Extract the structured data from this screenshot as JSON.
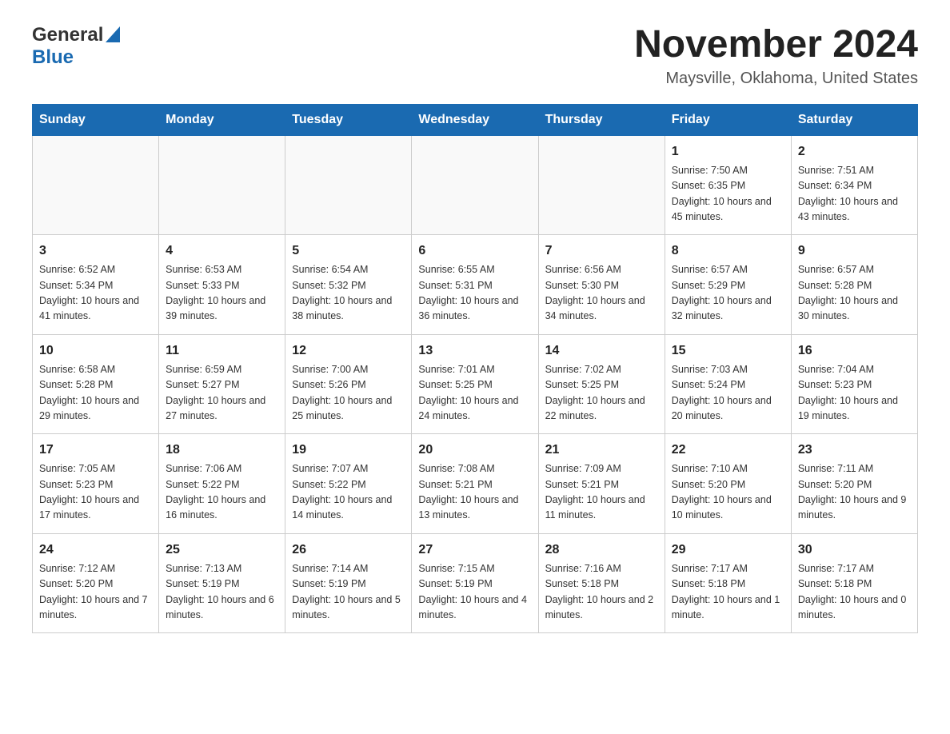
{
  "header": {
    "logo_general": "General",
    "logo_blue": "Blue",
    "month_title": "November 2024",
    "location": "Maysville, Oklahoma, United States"
  },
  "days_of_week": [
    "Sunday",
    "Monday",
    "Tuesday",
    "Wednesday",
    "Thursday",
    "Friday",
    "Saturday"
  ],
  "weeks": [
    [
      {
        "day": "",
        "sunrise": "",
        "sunset": "",
        "daylight": ""
      },
      {
        "day": "",
        "sunrise": "",
        "sunset": "",
        "daylight": ""
      },
      {
        "day": "",
        "sunrise": "",
        "sunset": "",
        "daylight": ""
      },
      {
        "day": "",
        "sunrise": "",
        "sunset": "",
        "daylight": ""
      },
      {
        "day": "",
        "sunrise": "",
        "sunset": "",
        "daylight": ""
      },
      {
        "day": "1",
        "sunrise": "Sunrise: 7:50 AM",
        "sunset": "Sunset: 6:35 PM",
        "daylight": "Daylight: 10 hours and 45 minutes."
      },
      {
        "day": "2",
        "sunrise": "Sunrise: 7:51 AM",
        "sunset": "Sunset: 6:34 PM",
        "daylight": "Daylight: 10 hours and 43 minutes."
      }
    ],
    [
      {
        "day": "3",
        "sunrise": "Sunrise: 6:52 AM",
        "sunset": "Sunset: 5:34 PM",
        "daylight": "Daylight: 10 hours and 41 minutes."
      },
      {
        "day": "4",
        "sunrise": "Sunrise: 6:53 AM",
        "sunset": "Sunset: 5:33 PM",
        "daylight": "Daylight: 10 hours and 39 minutes."
      },
      {
        "day": "5",
        "sunrise": "Sunrise: 6:54 AM",
        "sunset": "Sunset: 5:32 PM",
        "daylight": "Daylight: 10 hours and 38 minutes."
      },
      {
        "day": "6",
        "sunrise": "Sunrise: 6:55 AM",
        "sunset": "Sunset: 5:31 PM",
        "daylight": "Daylight: 10 hours and 36 minutes."
      },
      {
        "day": "7",
        "sunrise": "Sunrise: 6:56 AM",
        "sunset": "Sunset: 5:30 PM",
        "daylight": "Daylight: 10 hours and 34 minutes."
      },
      {
        "day": "8",
        "sunrise": "Sunrise: 6:57 AM",
        "sunset": "Sunset: 5:29 PM",
        "daylight": "Daylight: 10 hours and 32 minutes."
      },
      {
        "day": "9",
        "sunrise": "Sunrise: 6:57 AM",
        "sunset": "Sunset: 5:28 PM",
        "daylight": "Daylight: 10 hours and 30 minutes."
      }
    ],
    [
      {
        "day": "10",
        "sunrise": "Sunrise: 6:58 AM",
        "sunset": "Sunset: 5:28 PM",
        "daylight": "Daylight: 10 hours and 29 minutes."
      },
      {
        "day": "11",
        "sunrise": "Sunrise: 6:59 AM",
        "sunset": "Sunset: 5:27 PM",
        "daylight": "Daylight: 10 hours and 27 minutes."
      },
      {
        "day": "12",
        "sunrise": "Sunrise: 7:00 AM",
        "sunset": "Sunset: 5:26 PM",
        "daylight": "Daylight: 10 hours and 25 minutes."
      },
      {
        "day": "13",
        "sunrise": "Sunrise: 7:01 AM",
        "sunset": "Sunset: 5:25 PM",
        "daylight": "Daylight: 10 hours and 24 minutes."
      },
      {
        "day": "14",
        "sunrise": "Sunrise: 7:02 AM",
        "sunset": "Sunset: 5:25 PM",
        "daylight": "Daylight: 10 hours and 22 minutes."
      },
      {
        "day": "15",
        "sunrise": "Sunrise: 7:03 AM",
        "sunset": "Sunset: 5:24 PM",
        "daylight": "Daylight: 10 hours and 20 minutes."
      },
      {
        "day": "16",
        "sunrise": "Sunrise: 7:04 AM",
        "sunset": "Sunset: 5:23 PM",
        "daylight": "Daylight: 10 hours and 19 minutes."
      }
    ],
    [
      {
        "day": "17",
        "sunrise": "Sunrise: 7:05 AM",
        "sunset": "Sunset: 5:23 PM",
        "daylight": "Daylight: 10 hours and 17 minutes."
      },
      {
        "day": "18",
        "sunrise": "Sunrise: 7:06 AM",
        "sunset": "Sunset: 5:22 PM",
        "daylight": "Daylight: 10 hours and 16 minutes."
      },
      {
        "day": "19",
        "sunrise": "Sunrise: 7:07 AM",
        "sunset": "Sunset: 5:22 PM",
        "daylight": "Daylight: 10 hours and 14 minutes."
      },
      {
        "day": "20",
        "sunrise": "Sunrise: 7:08 AM",
        "sunset": "Sunset: 5:21 PM",
        "daylight": "Daylight: 10 hours and 13 minutes."
      },
      {
        "day": "21",
        "sunrise": "Sunrise: 7:09 AM",
        "sunset": "Sunset: 5:21 PM",
        "daylight": "Daylight: 10 hours and 11 minutes."
      },
      {
        "day": "22",
        "sunrise": "Sunrise: 7:10 AM",
        "sunset": "Sunset: 5:20 PM",
        "daylight": "Daylight: 10 hours and 10 minutes."
      },
      {
        "day": "23",
        "sunrise": "Sunrise: 7:11 AM",
        "sunset": "Sunset: 5:20 PM",
        "daylight": "Daylight: 10 hours and 9 minutes."
      }
    ],
    [
      {
        "day": "24",
        "sunrise": "Sunrise: 7:12 AM",
        "sunset": "Sunset: 5:20 PM",
        "daylight": "Daylight: 10 hours and 7 minutes."
      },
      {
        "day": "25",
        "sunrise": "Sunrise: 7:13 AM",
        "sunset": "Sunset: 5:19 PM",
        "daylight": "Daylight: 10 hours and 6 minutes."
      },
      {
        "day": "26",
        "sunrise": "Sunrise: 7:14 AM",
        "sunset": "Sunset: 5:19 PM",
        "daylight": "Daylight: 10 hours and 5 minutes."
      },
      {
        "day": "27",
        "sunrise": "Sunrise: 7:15 AM",
        "sunset": "Sunset: 5:19 PM",
        "daylight": "Daylight: 10 hours and 4 minutes."
      },
      {
        "day": "28",
        "sunrise": "Sunrise: 7:16 AM",
        "sunset": "Sunset: 5:18 PM",
        "daylight": "Daylight: 10 hours and 2 minutes."
      },
      {
        "day": "29",
        "sunrise": "Sunrise: 7:17 AM",
        "sunset": "Sunset: 5:18 PM",
        "daylight": "Daylight: 10 hours and 1 minute."
      },
      {
        "day": "30",
        "sunrise": "Sunrise: 7:17 AM",
        "sunset": "Sunset: 5:18 PM",
        "daylight": "Daylight: 10 hours and 0 minutes."
      }
    ]
  ]
}
